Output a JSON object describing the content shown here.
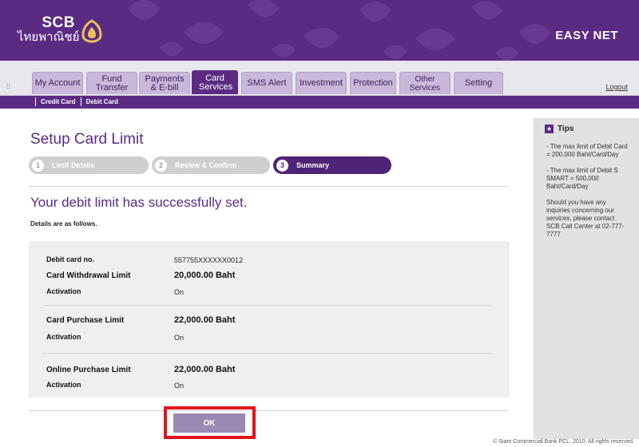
{
  "header": {
    "brand": "SCB",
    "brand_thai": "ไทยพาณิชย์",
    "product": "EASY NET"
  },
  "tabs": [
    {
      "label": "My Account",
      "active": false
    },
    {
      "label": "Fund Transfer",
      "active": false
    },
    {
      "label": "Payments & E-bill",
      "active": false
    },
    {
      "label": "Card Services",
      "active": true
    },
    {
      "label": "SMS Alert",
      "active": false
    },
    {
      "label": "Investment",
      "active": false
    },
    {
      "label": "Protection",
      "active": false
    },
    {
      "label": "Other Services",
      "active": false
    },
    {
      "label": "Setting",
      "active": false
    }
  ],
  "logout": "Logout",
  "subnav": [
    "Credit Card",
    "Debit Card"
  ],
  "page": {
    "title": "Setup Card Limit",
    "steps": [
      {
        "num": "1",
        "label": "Limit Details"
      },
      {
        "num": "2",
        "label": "Review & Confirm"
      },
      {
        "num": "3",
        "label": "Summary"
      }
    ],
    "success": "Your debit limit has successfully set.",
    "details_note": "Details are as follows."
  },
  "details": {
    "card_no_label": "Debit card no.",
    "card_no": "557755XXXXXX0012",
    "withdrawal_label": "Card  Withdrawal  Limit",
    "withdrawal_value": "20,000.00 Baht",
    "withdrawal_activation_label": "Activation",
    "withdrawal_activation": "On",
    "purchase_label": "Card  Purchase  Limit",
    "purchase_value": "22,000.00 Baht",
    "purchase_activation_label": "Activation",
    "purchase_activation": "On",
    "online_label": "Online  Purchase  Limit",
    "online_value": "22,000.00 Baht",
    "online_activation_label": "Activation",
    "online_activation": "On"
  },
  "ok_label": "OK",
  "tips": {
    "title": "Tips",
    "items": [
      "- The max limit of Debit Card = 200,000 Baht/Card/Day",
      "- The max limit of Debit S SMART = 500,000 Baht/Card/Day",
      "Should you have any inquiries concerning our services, please contact SCB Call Center at 02-777-7777"
    ]
  },
  "footer": "© Siam Commercial Bank PCL. 2010. All rights reserved.",
  "colors": {
    "brand_purple": "#5b2b84",
    "highlight_red": "#e3131a",
    "ok_button": "#9b88b3"
  }
}
